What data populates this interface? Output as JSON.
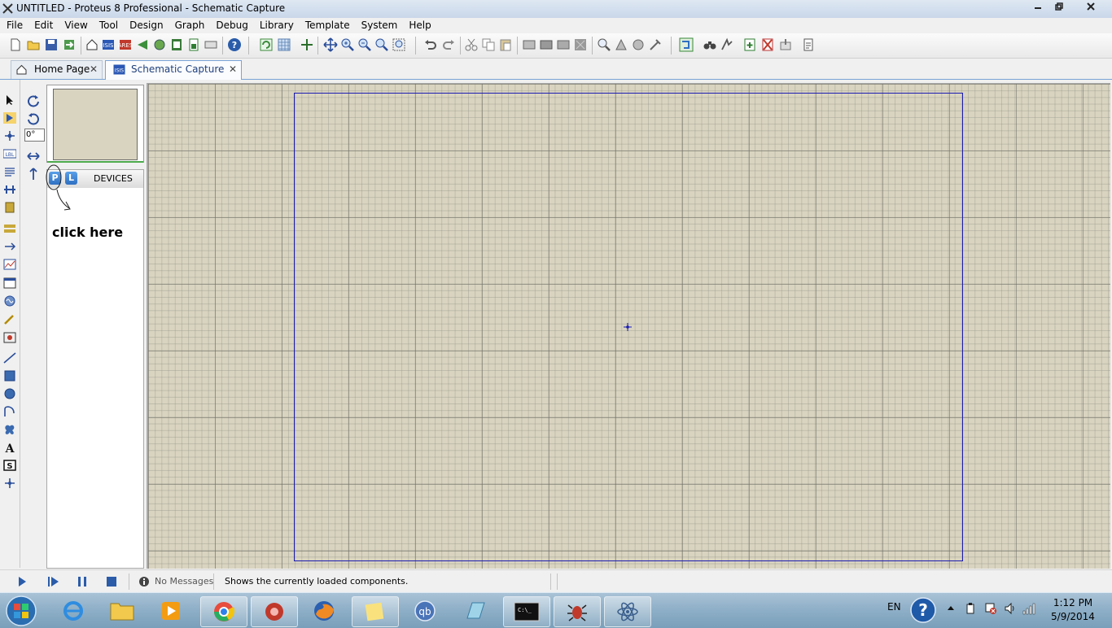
{
  "window": {
    "title": "UNTITLED - Proteus 8 Professional - Schematic Capture",
    "controls": [
      "minimize",
      "restore",
      "close"
    ]
  },
  "menu": [
    "File",
    "Edit",
    "View",
    "Tool",
    "Design",
    "Graph",
    "Debug",
    "Library",
    "Template",
    "System",
    "Help"
  ],
  "tabs": [
    {
      "label": "Home Page",
      "icon": "home-icon",
      "active": false
    },
    {
      "label": "Schematic Capture",
      "icon": "schematic-icon",
      "active": true
    }
  ],
  "left_panel": {
    "rotation_value": "0°",
    "picker_buttons": [
      "P",
      "L"
    ],
    "devices_label": "DEVICES",
    "annotation": "click here"
  },
  "status": {
    "messages_label": "No Messages",
    "hint": "Shows the currently loaded components."
  },
  "taskbar": {
    "language": "EN",
    "time": "1:12 PM",
    "date": "5/9/2014"
  },
  "colors": {
    "canvas": "#d9d4c0",
    "sheet_border": "#1b1bb0",
    "taskbar": "#8fb0c8"
  }
}
